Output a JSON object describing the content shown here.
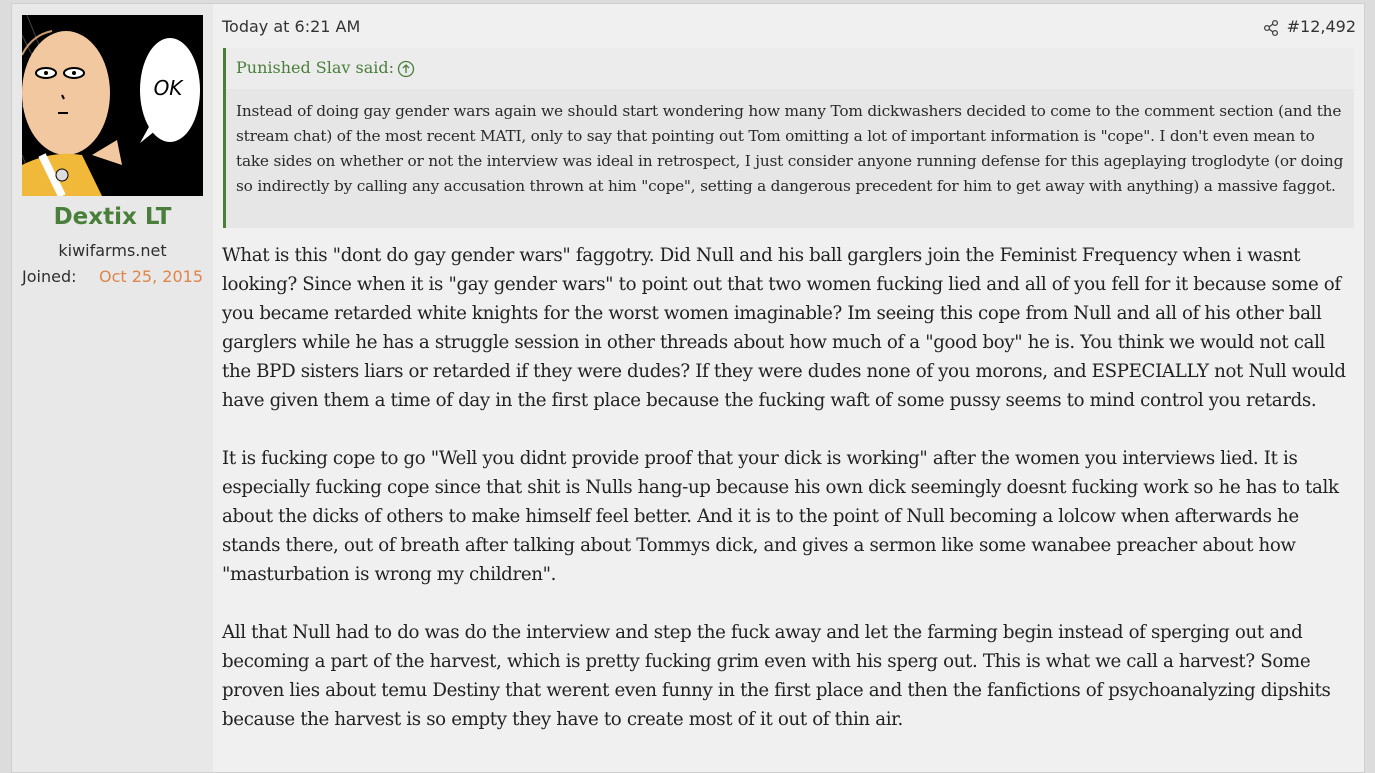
{
  "user": {
    "name": "Dextix LT",
    "title": "kiwifarms.net",
    "joined_label": "Joined:",
    "joined_date": "Oct 25, 2015",
    "avatar_text": "OK",
    "avatar_icon": "bald-hero-avatar-icon"
  },
  "meta": {
    "time": "Today at 6:21 AM",
    "post_number": "#12,492",
    "share_icon": "share-icon"
  },
  "quote": {
    "author": "Punished Slav said:",
    "jump_icon": "arrow-up-circle-icon",
    "text": "Instead of doing gay gender wars again we should start wondering how many Tom dickwashers decided to come to the comment section (and the stream chat) of the most recent MATI, only to say that pointing out Tom omitting a lot of important information is \"cope\". I don't even mean to take sides on whether or not the interview was ideal in retrospect, I just consider anyone running defense for this ageplaying troglodyte (or doing so indirectly by calling any accusation thrown at him \"cope\", setting a dangerous precedent for him to get away with anything) a massive faggot."
  },
  "body": {
    "paragraphs": [
      "What is this \"dont do gay gender wars\" faggotry. Did Null and his ball garglers join the Feminist Frequency when i wasnt looking? Since when it is \"gay gender wars\" to point out that two women fucking lied and all of you fell for it because some of you became retarded white knights for the worst women imaginable? Im seeing this cope from Null and all of his other ball garglers while he has a struggle session in other threads about how much of a \"good boy\" he is. You think we would not call the BPD sisters liars or retarded if they were dudes? If they were dudes none of you morons, and ESPECIALLY not Null would have given them a time of day in the first place because the fucking waft of some pussy seems to mind control you retards.",
      "It is fucking cope to go \"Well you didnt provide proof that your dick is working\" after the women you interviews lied. It is especially fucking cope since that shit is Nulls hang-up because his own dick seemingly doesnt fucking work so he has to talk about the dicks of others to make himself feel better. And it is to the point of Null becoming a lolcow when afterwards he stands there, out of breath after talking about Tommys dick, and gives a sermon like some wanabee preacher about how \"masturbation is wrong my children\".",
      "All that Null had to do was do the interview and step the fuck away and let the farming begin instead of sperging out and becoming a part of the harvest, which is pretty fucking grim even with his sperg out. This is what we call a harvest? Some proven lies about temu Destiny that werent even funny in the first place and then the fanfictions of psychoanalyzing dipshits because the harvest is so empty they have to create most of it out of thin air."
    ]
  },
  "colors": {
    "username": "#4a7f3b",
    "joined_date": "#e0844a",
    "quote_border": "#4a7f3b"
  }
}
